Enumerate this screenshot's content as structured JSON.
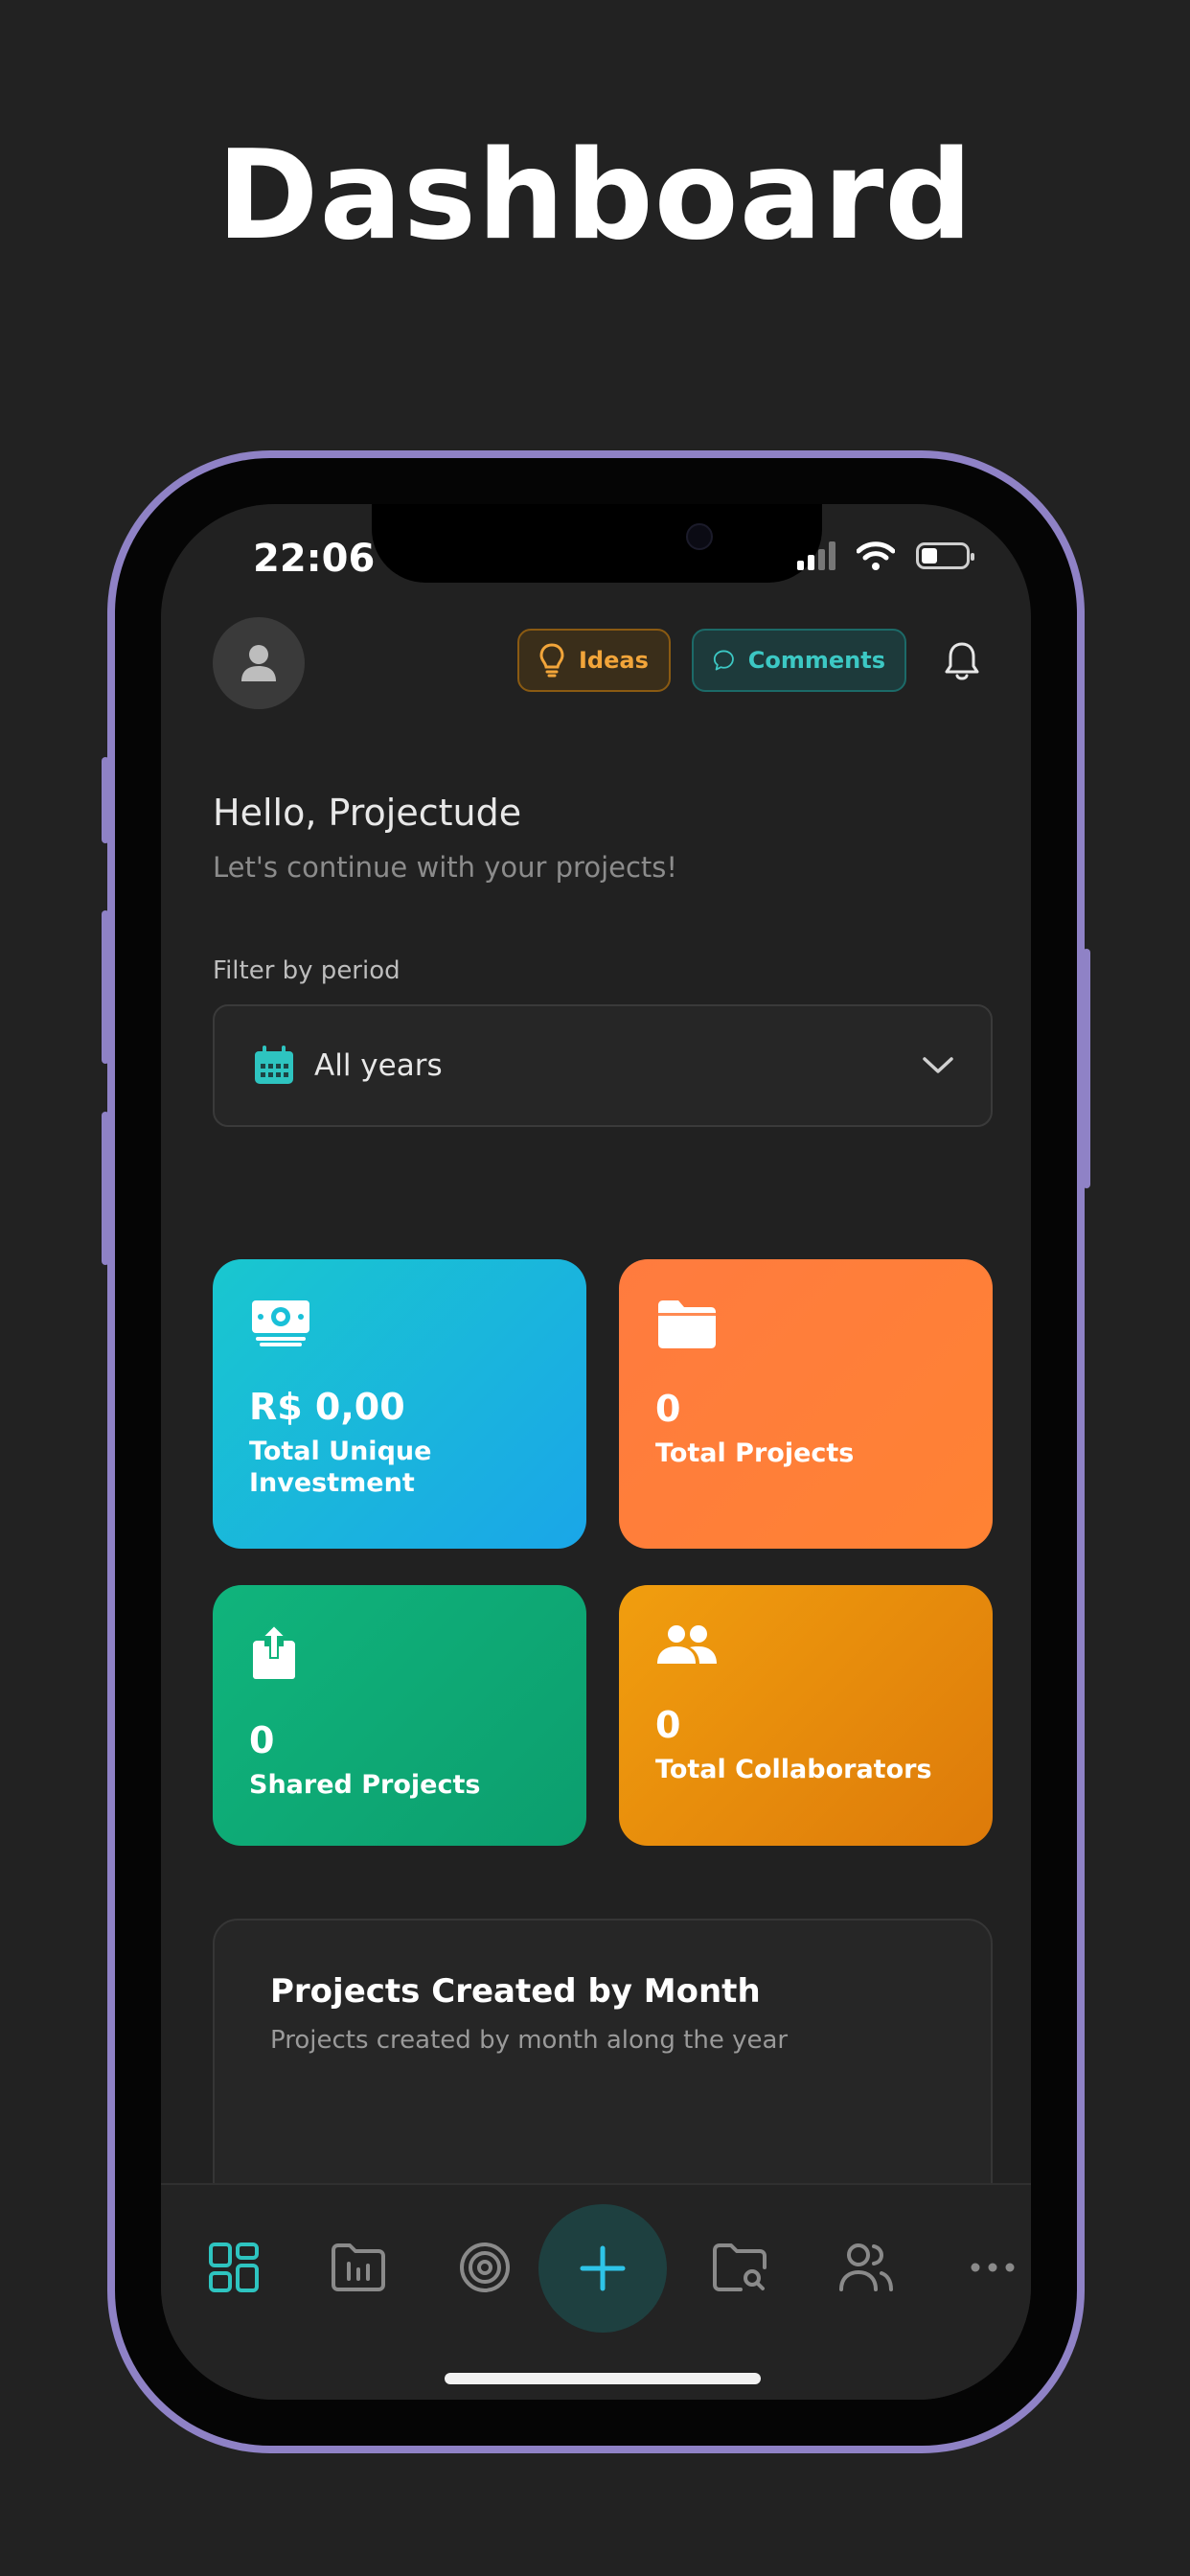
{
  "page": {
    "heading": "Dashboard"
  },
  "status_bar": {
    "time": "22:06"
  },
  "header": {
    "ideas_label": "Ideas",
    "comments_label": "Comments"
  },
  "greeting": {
    "title": "Hello, Projectude",
    "subtitle": "Let's continue with your projects!"
  },
  "filter": {
    "label": "Filter by period",
    "selected": "All years"
  },
  "stats": {
    "investment": {
      "value": "R$ 0,00",
      "label": "Total Unique Investment"
    },
    "projects": {
      "value": "0",
      "label": "Total Projects"
    },
    "shared": {
      "value": "0",
      "label": "Shared Projects"
    },
    "collaborators": {
      "value": "0",
      "label": "Total Collaborators"
    }
  },
  "chart_card": {
    "title": "Projects Created by Month",
    "subtitle": "Projects created by month along the year"
  },
  "tabbar": {
    "items": [
      "dashboard-icon",
      "projects-icon",
      "target-icon",
      "plus-icon",
      "folder-search-icon",
      "users-icon",
      "more-icon"
    ]
  },
  "colors": {
    "accent": "#2ec4c0",
    "ideas": "#f2a53a",
    "investment": "#19c7cf",
    "projects": "#ff7b3f",
    "shared": "#10b47c",
    "collaborators": "#f19e0e"
  }
}
